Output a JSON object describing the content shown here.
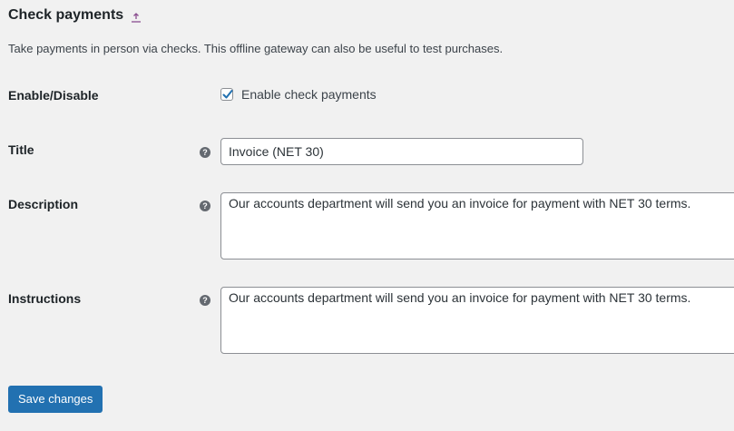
{
  "section": {
    "title": "Check payments",
    "description": "Take payments in person via checks. This offline gateway can also be useful to test purchases."
  },
  "fields": {
    "enable": {
      "label": "Enable/Disable",
      "checkbox_label": "Enable check payments",
      "checked": true
    },
    "title": {
      "label": "Title",
      "value": "Invoice (NET 30)",
      "help": "?"
    },
    "description": {
      "label": "Description",
      "value": "Our accounts department will send you an invoice for payment with NET 30 terms.",
      "help": "?"
    },
    "instructions": {
      "label": "Instructions",
      "value": "Our accounts department will send you an invoice for payment with NET 30 terms.",
      "help": "?"
    }
  },
  "actions": {
    "save_label": "Save changes"
  },
  "colors": {
    "primary": "#2271b1",
    "link": "#8a4d8f",
    "background": "#f1f1f1"
  },
  "icons": {
    "return": "return-arrow-icon",
    "help": "help-tip-icon",
    "check": "checkmark-icon"
  }
}
